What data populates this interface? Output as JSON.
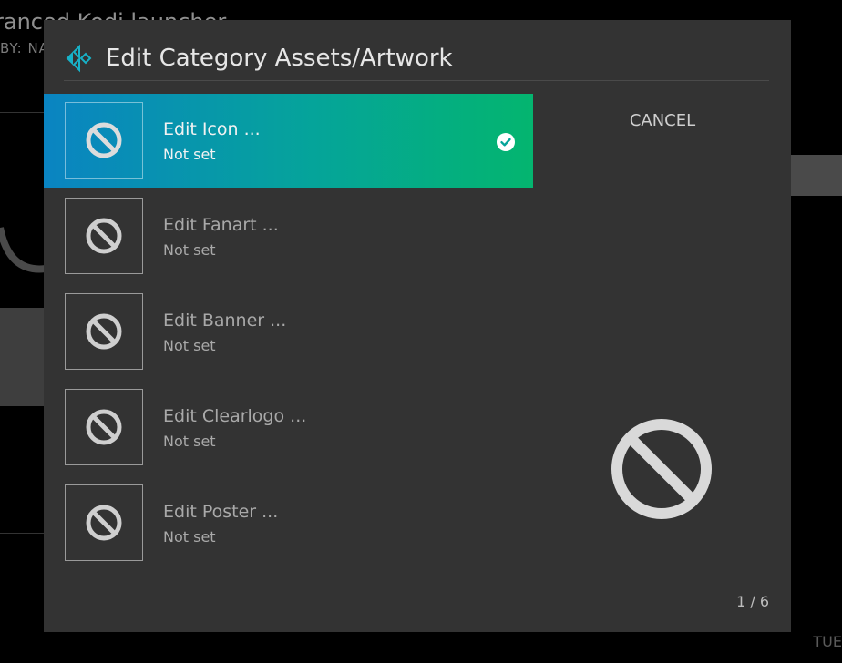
{
  "background": {
    "title": "ranced Kodi launcher",
    "subtitle": "BY: NA",
    "corner_text": "TUE"
  },
  "dialog": {
    "title": "Edit Category Assets/Artwork",
    "cancel_label": "CANCEL",
    "counter": "1 / 6",
    "items": [
      {
        "label": "Edit Icon ...",
        "value": "Not set",
        "selected": true
      },
      {
        "label": "Edit Fanart ...",
        "value": "Not set",
        "selected": false
      },
      {
        "label": "Edit Banner ...",
        "value": "Not set",
        "selected": false
      },
      {
        "label": "Edit Clearlogo ...",
        "value": "Not set",
        "selected": false
      },
      {
        "label": "Edit Poster ...",
        "value": "Not set",
        "selected": false
      }
    ]
  },
  "icons": {
    "thumbnail": "not-set-icon",
    "preview": "not-set-icon",
    "selected_marker": "check-circle-icon",
    "logo": "kodi-logo-icon"
  },
  "colors": {
    "selected_gradient_start": "#0a84c2",
    "selected_gradient_end": "#04b56f",
    "dialog_bg": "#333333",
    "logo_accent": "#17b2c8"
  }
}
